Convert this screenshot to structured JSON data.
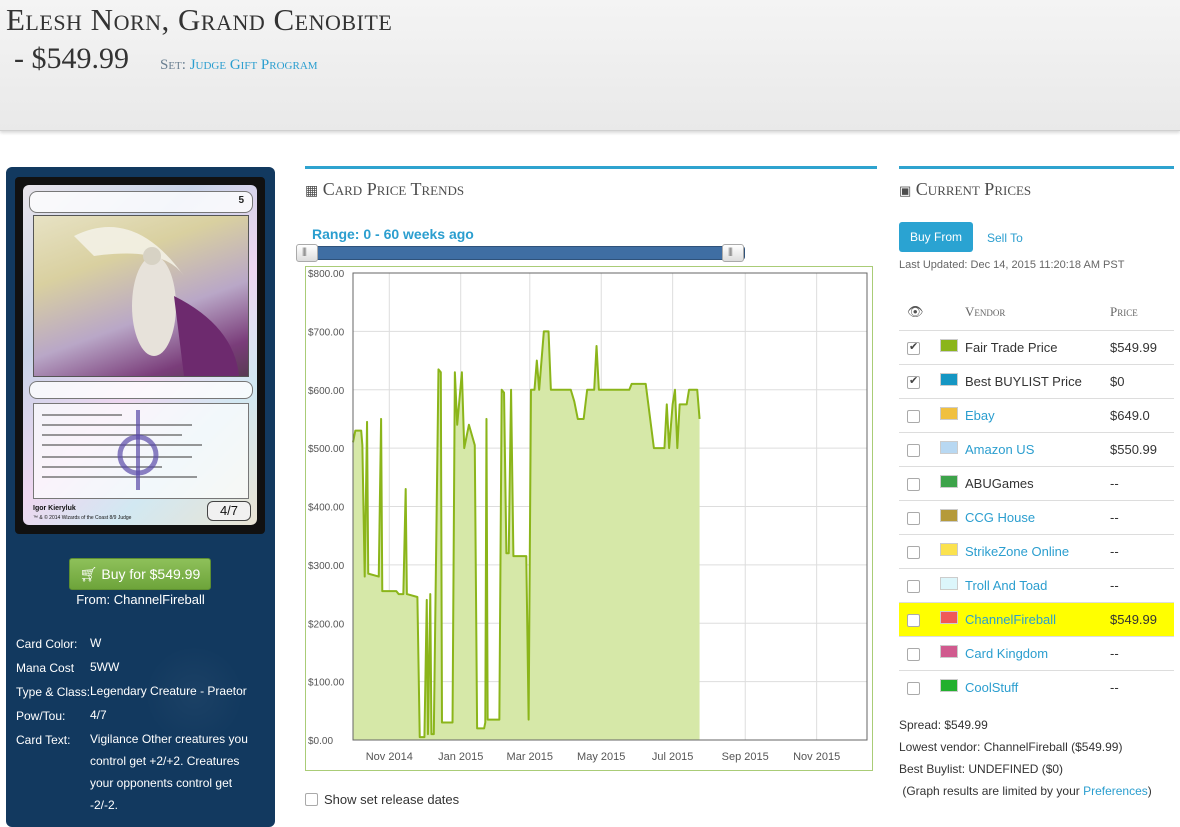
{
  "header": {
    "card_name": "Elesh Norn, Grand Cenobite",
    "price": " - $549.99",
    "set_label": "Set:",
    "set_name": "Judge Gift Program"
  },
  "card": {
    "buy_button": "Buy for $549.99",
    "buy_from": "From: ChannelFireball",
    "art_artist": "Igor Kieryluk",
    "art_footer": "™ & © 2014 Wizards of the Coast 8/9 Judge",
    "mana_symbol": "5",
    "pt": "4/7",
    "attributes": [
      {
        "key": "Card Color:",
        "value": "W"
      },
      {
        "key": "Mana Cost",
        "value": "5WW"
      },
      {
        "key": "Type & Class:",
        "value": "Legendary Creature - Praetor"
      },
      {
        "key": "Pow/Tou:",
        "value": "4/7"
      },
      {
        "key": "Card Text:",
        "value": "Vigilance Other creatures you control get +2/+2. Creatures your opponents control get -2/-2."
      }
    ]
  },
  "trends": {
    "title": "Card Price Trends",
    "range_label": "Range: 0 - 60 weeks ago",
    "show_release_dates": "Show set release dates"
  },
  "prices": {
    "title": "Current Prices",
    "buy_tab": "Buy From",
    "sell_tab": "Sell To",
    "last_updated": "Last Updated: Dec 14, 2015 11:20:18 AM PST",
    "col_vendor": "Vendor",
    "col_price": "Price",
    "vendors": [
      {
        "name": "Fair Trade Price",
        "price": "$549.99",
        "color": "#8bb51a",
        "checked": true,
        "link": false,
        "highlight": false
      },
      {
        "name": "Best BUYLIST Price",
        "price": "$0",
        "color": "#1596c3",
        "checked": true,
        "link": false,
        "highlight": false
      },
      {
        "name": "Ebay",
        "price": "$649.0",
        "color": "#f0c040",
        "checked": false,
        "link": true,
        "highlight": false
      },
      {
        "name": "Amazon US",
        "price": "$550.99",
        "color": "#b8d8f2",
        "checked": false,
        "link": true,
        "highlight": false
      },
      {
        "name": "ABUGames",
        "price": "--",
        "color": "#3da34a",
        "checked": false,
        "link": false,
        "highlight": false
      },
      {
        "name": "CCG House",
        "price": "--",
        "color": "#b59a3a",
        "checked": false,
        "link": true,
        "highlight": false
      },
      {
        "name": "StrikeZone Online",
        "price": "--",
        "color": "#fbe24e",
        "checked": false,
        "link": true,
        "highlight": false
      },
      {
        "name": "Troll And Toad",
        "price": "--",
        "color": "#dcf6fb",
        "checked": false,
        "link": true,
        "highlight": false
      },
      {
        "name": "ChannelFireball",
        "price": "$549.99",
        "color": "#f05858",
        "checked": false,
        "link": true,
        "highlight": true
      },
      {
        "name": "Card Kingdom",
        "price": "--",
        "color": "#d05a8e",
        "checked": false,
        "link": true,
        "highlight": false
      },
      {
        "name": "CoolStuff",
        "price": "--",
        "color": "#22b02e",
        "checked": false,
        "link": true,
        "highlight": false
      }
    ],
    "spread": "Spread: $549.99",
    "lowest": "Lowest vendor: ChannelFireball ($549.99)",
    "best_buylist": "Best Buylist: UNDEFINED ($0)",
    "note_prefix": " (Graph results are limited by your ",
    "note_link": "Preferences",
    "note_suffix": ")"
  },
  "chart_data": {
    "type": "area",
    "title": "",
    "xlabel": "",
    "ylabel": "",
    "ylim": [
      0,
      800
    ],
    "xlim": [
      "2014-10-01",
      "2015-12-14"
    ],
    "yticks": [
      "$0.00",
      "$100.00",
      "$200.00",
      "$300.00",
      "$400.00",
      "$500.00",
      "$600.00",
      "$700.00",
      "$800.00"
    ],
    "xticks": [
      {
        "label": "Nov 2014",
        "date": "2014-11-01"
      },
      {
        "label": "Jan 2015",
        "date": "2015-01-01"
      },
      {
        "label": "Mar 2015",
        "date": "2015-03-01"
      },
      {
        "label": "May 2015",
        "date": "2015-05-01"
      },
      {
        "label": "Jul 2015",
        "date": "2015-07-01"
      },
      {
        "label": "Sep 2015",
        "date": "2015-09-01"
      },
      {
        "label": "Nov 2015",
        "date": "2015-11-01"
      }
    ],
    "grid": true,
    "series": [
      {
        "name": "Fair Trade Price",
        "color": "#8bb51a",
        "points": [
          [
            "2014-10-01",
            510
          ],
          [
            "2014-10-03",
            530
          ],
          [
            "2014-10-08",
            530
          ],
          [
            "2014-10-09",
            505
          ],
          [
            "2014-10-11",
            280
          ],
          [
            "2014-10-13",
            545
          ],
          [
            "2014-10-14",
            285
          ],
          [
            "2014-10-23",
            280
          ],
          [
            "2014-10-25",
            550
          ],
          [
            "2014-10-26",
            255
          ],
          [
            "2014-11-07",
            255
          ],
          [
            "2014-11-09",
            250
          ],
          [
            "2014-11-13",
            250
          ],
          [
            "2014-11-15",
            430
          ],
          [
            "2014-11-16",
            250
          ],
          [
            "2014-11-25",
            245
          ],
          [
            "2014-11-27",
            5
          ],
          [
            "2014-12-01",
            5
          ],
          [
            "2014-12-03",
            240
          ],
          [
            "2014-12-04",
            10
          ],
          [
            "2014-12-06",
            250
          ],
          [
            "2014-12-07",
            10
          ],
          [
            "2014-12-09",
            10
          ],
          [
            "2014-12-13",
            635
          ],
          [
            "2014-12-15",
            630
          ],
          [
            "2014-12-16",
            30
          ],
          [
            "2014-12-25",
            30
          ],
          [
            "2014-12-27",
            630
          ],
          [
            "2014-12-29",
            540
          ],
          [
            "2015-01-02",
            630
          ],
          [
            "2015-01-04",
            500
          ],
          [
            "2015-01-08",
            540
          ],
          [
            "2015-01-13",
            505
          ],
          [
            "2015-01-15",
            20
          ],
          [
            "2015-01-21",
            20
          ],
          [
            "2015-01-22",
            30
          ],
          [
            "2015-01-23",
            550
          ],
          [
            "2015-01-24",
            35
          ],
          [
            "2015-02-03",
            35
          ],
          [
            "2015-02-05",
            600
          ],
          [
            "2015-02-07",
            595
          ],
          [
            "2015-02-09",
            320
          ],
          [
            "2015-02-11",
            320
          ],
          [
            "2015-02-13",
            600
          ],
          [
            "2015-02-15",
            315
          ],
          [
            "2015-02-26",
            315
          ],
          [
            "2015-02-28",
            35
          ],
          [
            "2015-03-02",
            600
          ],
          [
            "2015-03-05",
            600
          ],
          [
            "2015-03-07",
            650
          ],
          [
            "2015-03-09",
            600
          ],
          [
            "2015-03-11",
            650
          ],
          [
            "2015-03-13",
            700
          ],
          [
            "2015-03-17",
            700
          ],
          [
            "2015-03-19",
            600
          ],
          [
            "2015-04-05",
            600
          ],
          [
            "2015-04-08",
            580
          ],
          [
            "2015-04-11",
            550
          ],
          [
            "2015-04-16",
            550
          ],
          [
            "2015-04-19",
            600
          ],
          [
            "2015-04-25",
            600
          ],
          [
            "2015-04-27",
            675
          ],
          [
            "2015-04-29",
            600
          ],
          [
            "2015-05-25",
            600
          ],
          [
            "2015-05-27",
            610
          ],
          [
            "2015-06-08",
            610
          ],
          [
            "2015-06-15",
            500
          ],
          [
            "2015-06-24",
            500
          ],
          [
            "2015-06-26",
            575
          ],
          [
            "2015-06-28",
            500
          ],
          [
            "2015-07-01",
            575
          ],
          [
            "2015-07-03",
            600
          ],
          [
            "2015-07-05",
            500
          ],
          [
            "2015-07-07",
            575
          ],
          [
            "2015-07-13",
            575
          ],
          [
            "2015-07-15",
            600
          ],
          [
            "2015-07-22",
            600
          ],
          [
            "2015-07-24",
            550
          ]
        ]
      }
    ]
  }
}
